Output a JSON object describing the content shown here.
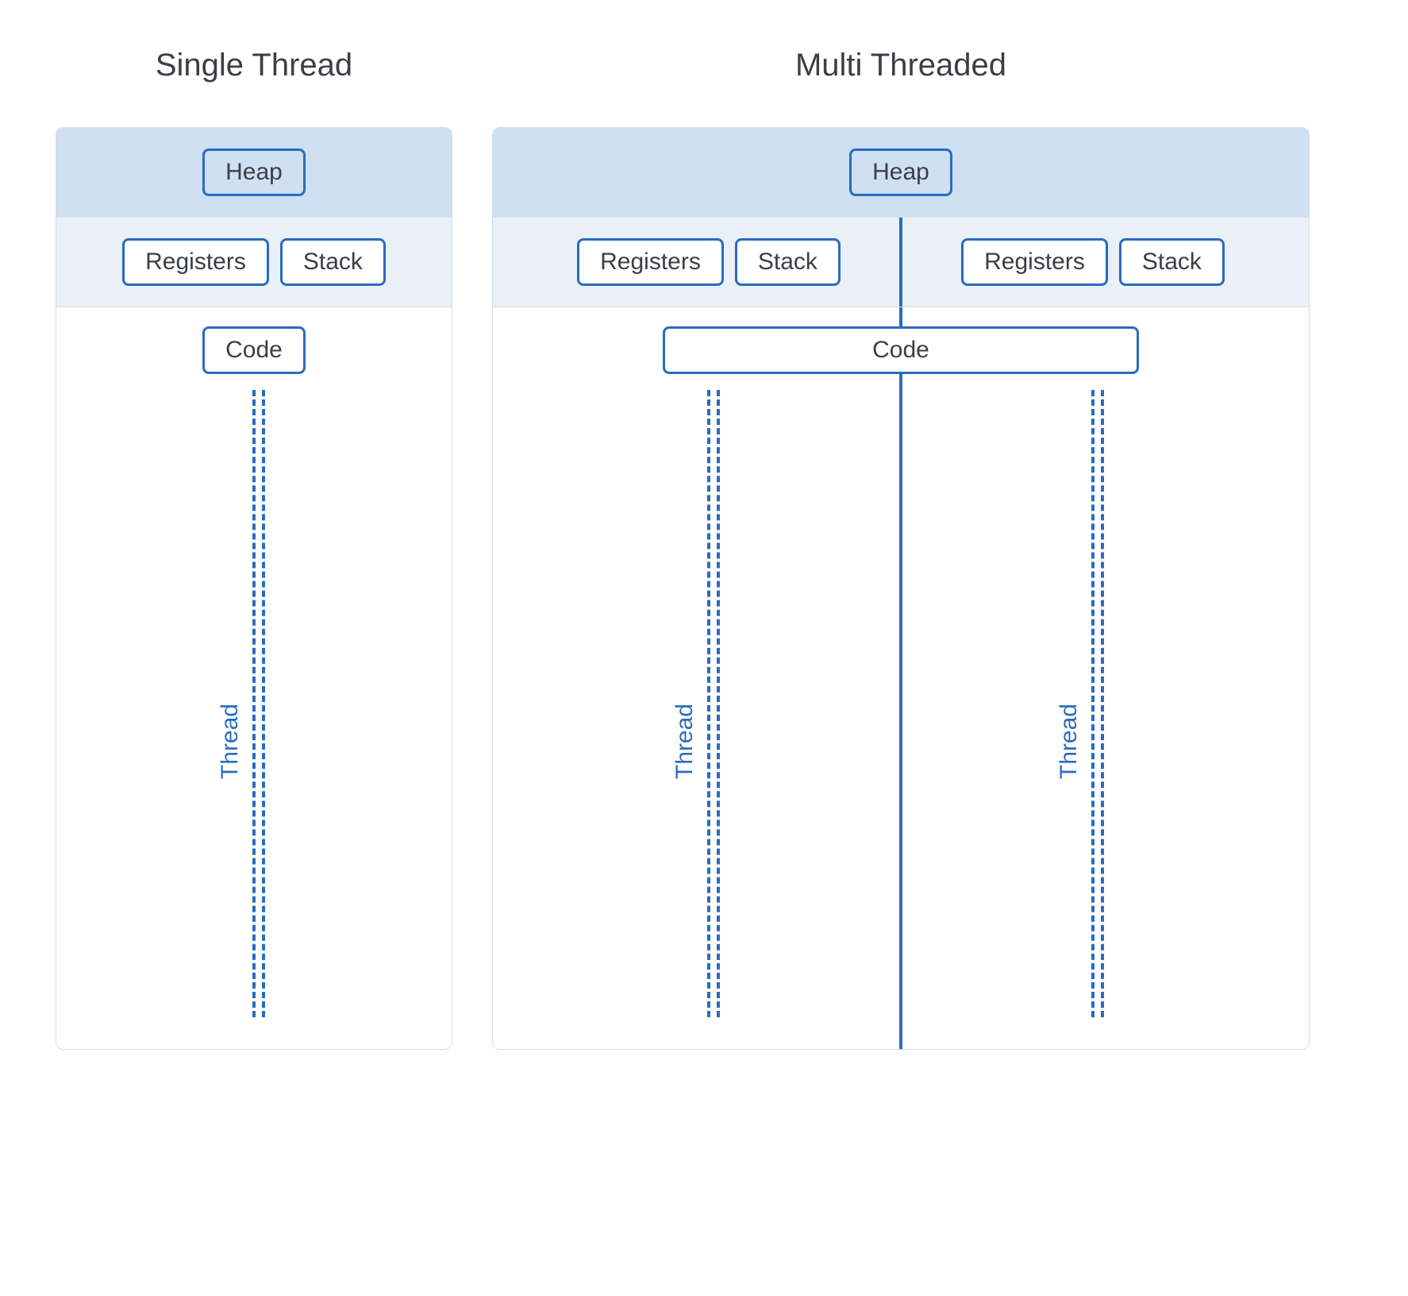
{
  "single": {
    "title": "Single Thread",
    "heap": "Heap",
    "registers": "Registers",
    "stack": "Stack",
    "code": "Code",
    "thread_label": "Thread"
  },
  "multi": {
    "title": "Multi Threaded",
    "heap": "Heap",
    "left": {
      "registers": "Registers",
      "stack": "Stack",
      "thread_label": "Thread"
    },
    "right": {
      "registers": "Registers",
      "stack": "Stack",
      "thread_label": "Thread"
    },
    "code": "Code"
  }
}
